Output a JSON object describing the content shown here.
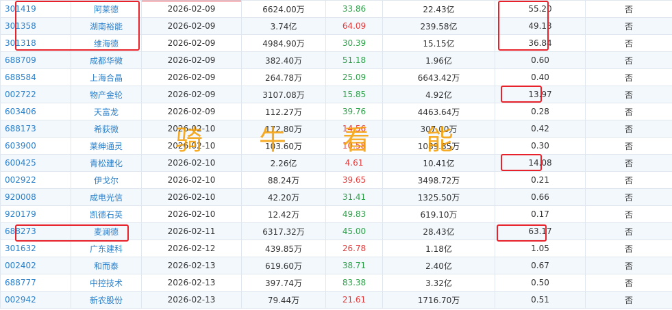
{
  "watermark": [
    "骑",
    "牛",
    "看",
    "能"
  ],
  "colors": {
    "link": "#2a7fc9",
    "up": "#e23a3a",
    "down": "#2fa04a",
    "highlight": "#e8222b"
  },
  "rows": [
    {
      "code": "301419",
      "name": "阿莱德",
      "date": "2026-02-09",
      "amount": "6624.00万",
      "pct": "33.86",
      "dir": "down",
      "cap": "22.43亿",
      "ratio": "55.20",
      "flag": "否"
    },
    {
      "code": "301358",
      "name": "湖南裕能",
      "date": "2026-02-09",
      "amount": "3.74亿",
      "pct": "64.09",
      "dir": "up",
      "cap": "239.58亿",
      "ratio": "49.13",
      "flag": "否"
    },
    {
      "code": "301318",
      "name": "维海德",
      "date": "2026-02-09",
      "amount": "4984.90万",
      "pct": "30.39",
      "dir": "down",
      "cap": "15.15亿",
      "ratio": "36.84",
      "flag": "否"
    },
    {
      "code": "688709",
      "name": "成都华微",
      "date": "2026-02-09",
      "amount": "382.40万",
      "pct": "51.18",
      "dir": "down",
      "cap": "1.96亿",
      "ratio": "0.60",
      "flag": "否"
    },
    {
      "code": "688584",
      "name": "上海合晶",
      "date": "2026-02-09",
      "amount": "264.78万",
      "pct": "25.09",
      "dir": "down",
      "cap": "6643.42万",
      "ratio": "0.40",
      "flag": "否"
    },
    {
      "code": "002722",
      "name": "物产金轮",
      "date": "2026-02-09",
      "amount": "3107.08万",
      "pct": "15.85",
      "dir": "down",
      "cap": "4.92亿",
      "ratio": "13.97",
      "flag": "否"
    },
    {
      "code": "603406",
      "name": "天富龙",
      "date": "2026-02-09",
      "amount": "112.27万",
      "pct": "39.76",
      "dir": "down",
      "cap": "4463.64万",
      "ratio": "0.28",
      "flag": "否"
    },
    {
      "code": "688173",
      "name": "希荻微",
      "date": "2026-02-10",
      "amount": "172.80万",
      "pct": "14.56",
      "dir": "up",
      "cap": "307.00万",
      "ratio": "0.42",
      "flag": "否"
    },
    {
      "code": "603900",
      "name": "莱绅通灵",
      "date": "2026-02-10",
      "amount": "103.60万",
      "pct": "10.58",
      "dir": "up",
      "cap": "1089.85万",
      "ratio": "0.30",
      "flag": "否"
    },
    {
      "code": "600425",
      "name": "青松建化",
      "date": "2026-02-10",
      "amount": "2.26亿",
      "pct": "4.61",
      "dir": "up",
      "cap": "10.41亿",
      "ratio": "14.08",
      "flag": "否"
    },
    {
      "code": "002922",
      "name": "伊戈尔",
      "date": "2026-02-10",
      "amount": "88.24万",
      "pct": "39.65",
      "dir": "up",
      "cap": "3498.72万",
      "ratio": "0.21",
      "flag": "否"
    },
    {
      "code": "920008",
      "name": "成电光信",
      "date": "2026-02-10",
      "amount": "42.20万",
      "pct": "31.41",
      "dir": "down",
      "cap": "1325.50万",
      "ratio": "0.66",
      "flag": "否"
    },
    {
      "code": "920179",
      "name": "凯德石英",
      "date": "2026-02-10",
      "amount": "12.42万",
      "pct": "49.83",
      "dir": "down",
      "cap": "619.10万",
      "ratio": "0.17",
      "flag": "否"
    },
    {
      "code": "688273",
      "name": "麦澜德",
      "date": "2026-02-11",
      "amount": "6317.32万",
      "pct": "45.00",
      "dir": "down",
      "cap": "28.43亿",
      "ratio": "63.17",
      "flag": "否"
    },
    {
      "code": "301632",
      "name": "广东建科",
      "date": "2026-02-12",
      "amount": "439.85万",
      "pct": "26.78",
      "dir": "up",
      "cap": "1.18亿",
      "ratio": "1.05",
      "flag": "否"
    },
    {
      "code": "002402",
      "name": "和而泰",
      "date": "2026-02-13",
      "amount": "619.60万",
      "pct": "38.71",
      "dir": "down",
      "cap": "2.40亿",
      "ratio": "0.67",
      "flag": "否"
    },
    {
      "code": "688777",
      "name": "中控技术",
      "date": "2026-02-13",
      "amount": "397.74万",
      "pct": "83.38",
      "dir": "down",
      "cap": "3.32亿",
      "ratio": "0.50",
      "flag": "否"
    },
    {
      "code": "002942",
      "name": "新农股份",
      "date": "2026-02-13",
      "amount": "79.44万",
      "pct": "21.61",
      "dir": "up",
      "cap": "1716.70万",
      "ratio": "0.51",
      "flag": "否"
    }
  ]
}
